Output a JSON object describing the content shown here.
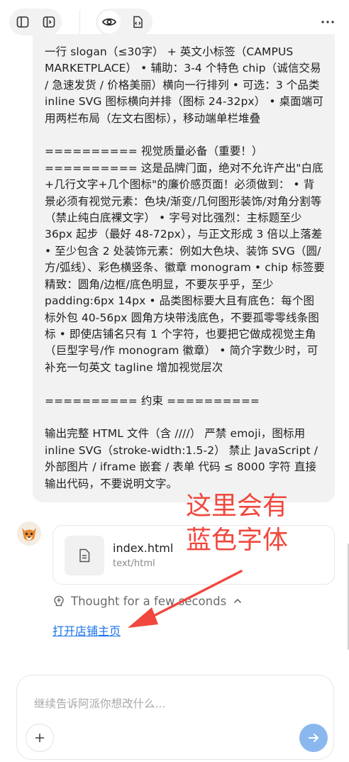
{
  "toolbar": {
    "icons": [
      "sidebar-toggle-icon",
      "panel-toggle-icon",
      "eye-preview-icon",
      "code-file-icon",
      "more-icon"
    ]
  },
  "message": {
    "text": "一行 slogan（≤30字） + 英文小标签（CAMPUS MARKETPLACE） • 辅助：3-4 个特色 chip（诚信交易 / 急速发货 / 价格美丽）横向一行排列 • 可选：3 个品类 inline SVG 图标横向并排（图标 24-32px） • 桌面端可用两栏布局（左文右图标），移动端单栏堆叠\n\n========== 视觉质量必备（重要！）========== 这是品牌门面，绝对不允许产出\"白底+几行文字+几个图标\"的廉价感页面！必须做到： • 背景必须有视觉元素：色块/渐变/几何图形装饰/对角分割等（禁止纯白底裸文字） • 字号对比强烈：主标题至少 36px 起步（最好 48-72px），与正文形成 3 倍以上落差 • 至少包含 2 处装饰元素：例如大色块、装饰 SVG（圆/方/弧线）、彩色横竖条、徽章 monogram • chip 标签要精致：圆角/边框/底色明显，不要灰乎乎，至少 padding:6px 14px • 品类图标要大且有底色：每个图标外包 40-56px 圆角方块带浅底色，不要孤零零线条图标 • 即使店铺名只有 1 个字符，也要把它做成视觉主角（巨型字号/作 monogram 徽章） • 简介字数少时，可补充一句英文 tagline 增加视觉层次\n\n========== 约束 ==========\n\n输出完整 HTML 文件（含 ////） 严禁 emoji，图标用 inline SVG（stroke-width:1.5-2） 禁止 JavaScript / 外部图片 / iframe 嵌套 / 表单 代码 ≤ 8000 字符 直接输出代码，不要说明文字。"
  },
  "assistant": {
    "avatar_icon": "fox-avatar-icon",
    "file": {
      "name": "index.html",
      "type": "text/html",
      "icon": "document-icon"
    },
    "thought_label": "Thought for a few seconds",
    "link_text": "打开店铺主页"
  },
  "annotation": {
    "text": "这里会有\n蓝色字体",
    "color": "#f0483e"
  },
  "composer": {
    "placeholder": "继续告诉阿派你想改什么..."
  },
  "colors": {
    "link": "#1a73e8",
    "send_button": "#8ab8ee",
    "bubble": "#f2f2f2"
  }
}
